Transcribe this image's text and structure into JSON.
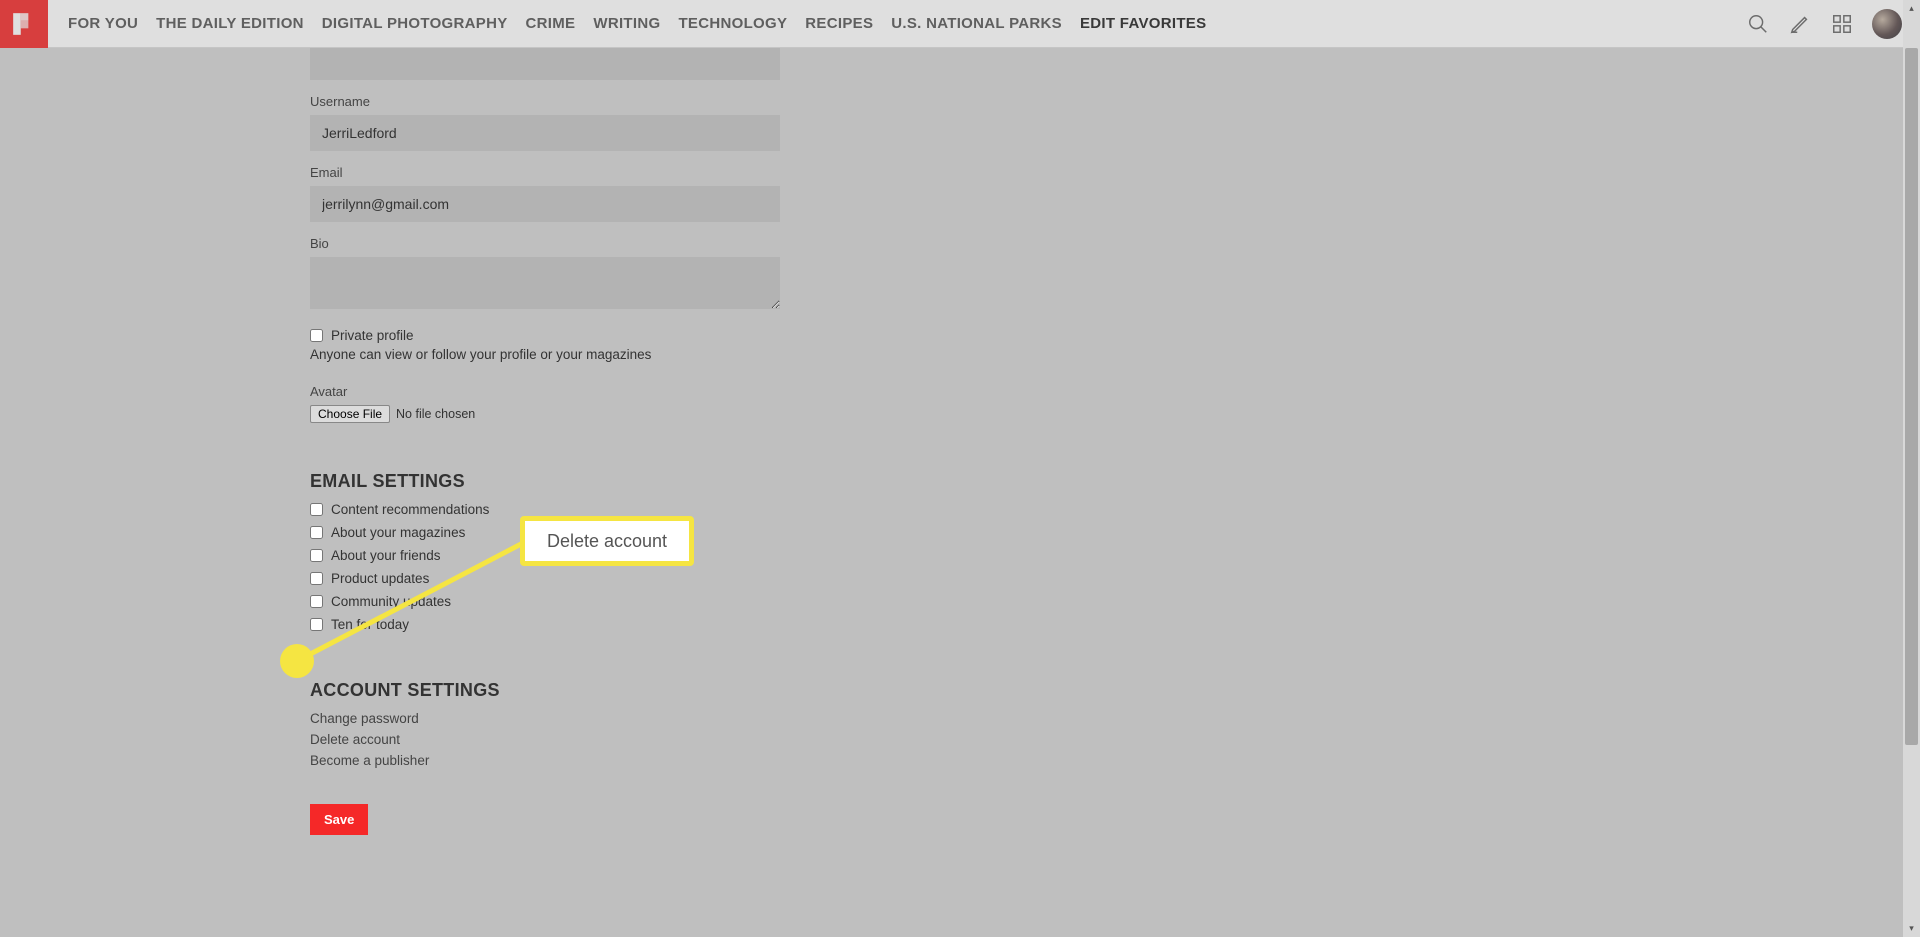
{
  "nav": {
    "items": [
      {
        "label": "FOR YOU"
      },
      {
        "label": "THE DAILY EDITION"
      },
      {
        "label": "DIGITAL PHOTOGRAPHY"
      },
      {
        "label": "CRIME"
      },
      {
        "label": "WRITING"
      },
      {
        "label": "TECHNOLOGY"
      },
      {
        "label": "RECIPES"
      },
      {
        "label": "U.S. NATIONAL PARKS"
      },
      {
        "label": "EDIT FAVORITES"
      }
    ]
  },
  "form": {
    "username_label": "Username",
    "username_value": "JerriLedford",
    "email_label": "Email",
    "email_value": "jerrilynn@gmail.com",
    "bio_label": "Bio",
    "bio_value": "",
    "private_label": "Private profile",
    "private_sub": "Anyone can view or follow your profile or your magazines",
    "avatar_label": "Avatar",
    "file_btn": "Choose File",
    "file_text": "No file chosen"
  },
  "email_settings": {
    "heading": "EMAIL SETTINGS",
    "items": [
      {
        "label": "Content recommendations"
      },
      {
        "label": "About your magazines"
      },
      {
        "label": "About your friends"
      },
      {
        "label": "Product updates"
      },
      {
        "label": "Community updates"
      },
      {
        "label": "Ten for today"
      }
    ]
  },
  "account_settings": {
    "heading": "ACCOUNT SETTINGS",
    "items": [
      {
        "label": "Change password"
      },
      {
        "label": "Delete account"
      },
      {
        "label": "Become a publisher"
      }
    ]
  },
  "save_label": "Save",
  "callout_text": "Delete account"
}
